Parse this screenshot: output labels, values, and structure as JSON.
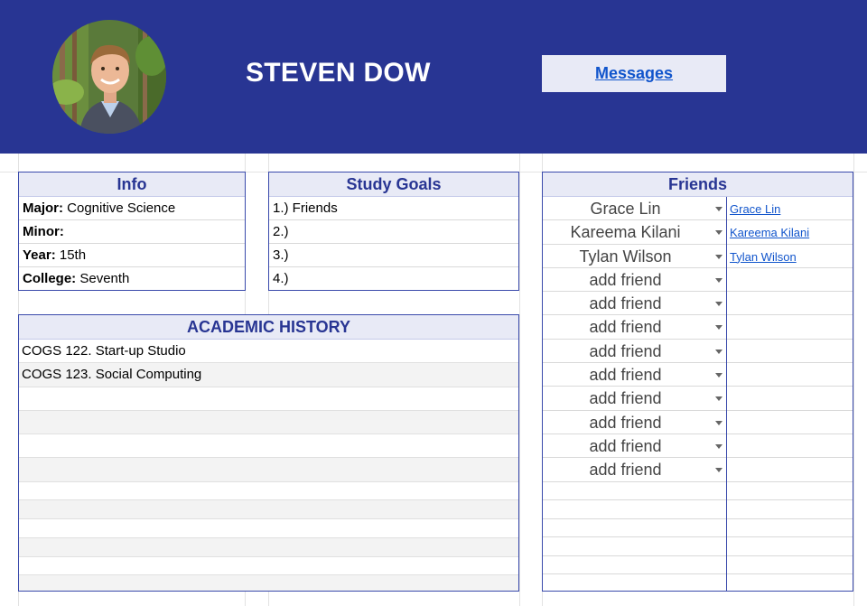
{
  "profile": {
    "name": "STEVEN DOW",
    "messages_label": "Messages"
  },
  "info": {
    "title": "Info",
    "rows": [
      {
        "label": "Major:",
        "value": " Cognitive Science"
      },
      {
        "label": "Minor:",
        "value": ""
      },
      {
        "label": "Year:",
        "value": " 15th"
      },
      {
        "label": "College:",
        "value": " Seventh"
      }
    ]
  },
  "study_goals": {
    "title": "Study Goals",
    "items": [
      "1.) Friends",
      "2.)",
      "3.)",
      "4.)"
    ]
  },
  "academic_history": {
    "title": "ACADEMIC HISTORY",
    "courses": [
      "COGS 122. Start-up Studio",
      "COGS 123. Social Computing"
    ]
  },
  "friends": {
    "title": "Friends",
    "dropdowns": [
      "Grace Lin",
      "Kareema Kilani",
      "Tylan Wilson",
      "add friend",
      "add friend",
      "add friend",
      "add friend",
      "add friend",
      "add friend",
      "add friend",
      "add friend",
      "add friend"
    ],
    "links": [
      "Grace Lin",
      "Kareema Kilani",
      "Tylan Wilson"
    ]
  },
  "colors": {
    "header_bg": "#283593",
    "panel_title_bg": "#e8eaf6",
    "accent_text": "#283593",
    "link": "#1155cc"
  }
}
